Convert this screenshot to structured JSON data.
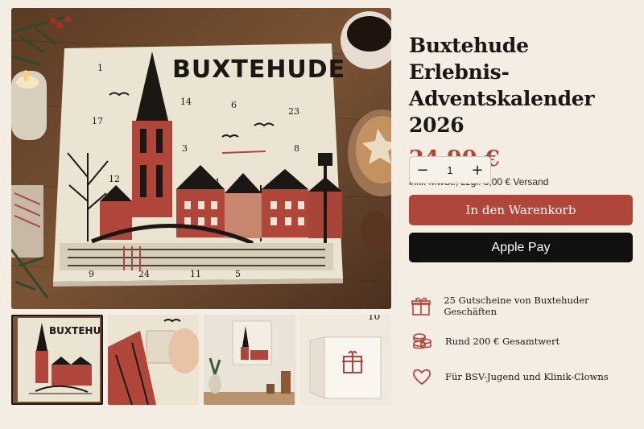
{
  "gallery": {
    "main_image": {
      "alt": "Adventskalender mit Stadtansicht",
      "card_title": "BUXTEHUDE",
      "door_numbers": [
        "1",
        "14",
        "6",
        "23",
        "17",
        "3",
        "8",
        "12",
        "14",
        "9",
        "24",
        "11",
        "5"
      ]
    },
    "thumbnails": [
      {
        "label": "BUXTEHUDE"
      },
      {
        "label": ""
      },
      {
        "label": ""
      },
      {
        "label": "10"
      }
    ]
  },
  "product": {
    "title_line1": "Buxtehude Erlebnis-",
    "title_line2": "Adventskalender 2026",
    "price": "24,90 €",
    "tax_note": "inkl. MwSt., zzgl. 3,00 € Versand",
    "quantity": "1",
    "minus_label": "−",
    "plus_label": "+",
    "add_to_cart": "In den Warenkorb",
    "apple_pay_label": "Apple Pay"
  },
  "features": [
    {
      "icon": "gift-icon",
      "text": "25 Gutscheine von Buxtehuder Geschäften"
    },
    {
      "icon": "coins-icon",
      "text": "Rund 200 € Gesamtwert"
    },
    {
      "icon": "heart-icon",
      "text": "Für BSV-Jugend und Klinik-Clowns"
    }
  ],
  "colors": {
    "accent": "#b0463a",
    "background": "#f3ede4",
    "dark": "#121110"
  }
}
